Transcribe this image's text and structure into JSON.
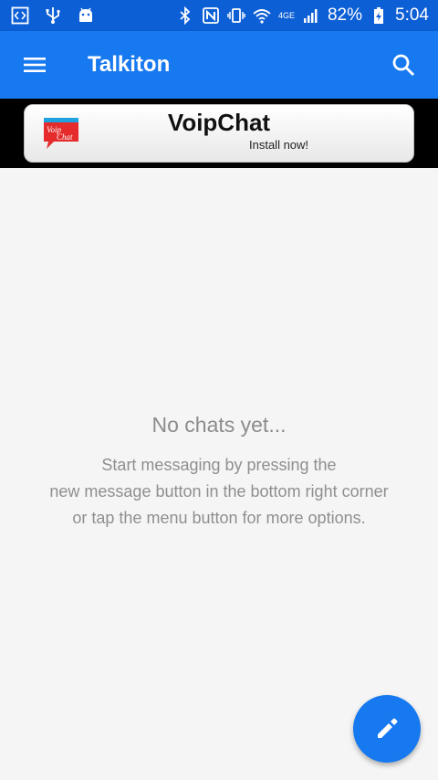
{
  "statusbar": {
    "battery": "82%",
    "time": "5:04",
    "network": "4GE",
    "left_icons": [
      "code-icon",
      "usb-icon",
      "android-icon"
    ],
    "right_icons": [
      "bluetooth-icon",
      "nfc-icon",
      "vibrate-icon",
      "wifi-icon",
      "signal-icon",
      "battery-charging-icon"
    ]
  },
  "appbar": {
    "title": "Talkiton",
    "menu_icon": "menu-icon",
    "search_icon": "search-icon"
  },
  "ad": {
    "name": "VoipChat",
    "cta": "Install now!",
    "logo_text_1": "Voip",
    "logo_text_2": "Chat"
  },
  "empty_state": {
    "title": "No chats yet...",
    "lines": [
      "Start messaging by pressing the",
      "new message button in the bottom right corner",
      "or tap the menu button for more options."
    ]
  },
  "fab": {
    "icon": "pencil-icon"
  },
  "colors": {
    "statusbar": "#0d5fd6",
    "appbar": "#1779f0",
    "background": "#f5f5f5",
    "text_muted": "#8c8c8c"
  }
}
